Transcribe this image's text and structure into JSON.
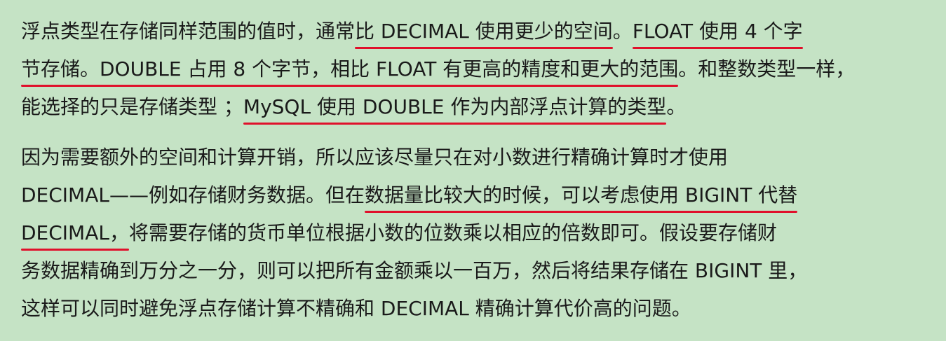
{
  "paragraphs": [
    {
      "lines": [
        [
          {
            "text": "浮点类型在存储同样范围的值时，通常",
            "underline": false,
            "style": ""
          },
          {
            "text": "比 DECIMAL 使用更少的空间",
            "underline": true,
            "style": ""
          },
          {
            "text": "。",
            "underline": false,
            "style": ""
          },
          {
            "text": "FLOAT 使用 4 个字",
            "underline": true,
            "style": ""
          }
        ],
        [
          {
            "text": "节存储。DOUBLE 占用 8 个字节，相比 FLOAT 有更高的精度和更大的范围",
            "underline": true,
            "style": ""
          },
          {
            "text": "。和整数类型一样，",
            "underline": false,
            "style": ""
          }
        ],
        [
          {
            "text": "能选择的只是存储类型 ；",
            "underline": false,
            "style": ""
          },
          {
            "text": "MySQL 使用 DOUBLE 作为内部浮点计算的类型",
            "underline": true,
            "style": ""
          },
          {
            "text": "。",
            "underline": false,
            "style": ""
          }
        ]
      ]
    },
    {
      "lines": [
        [
          {
            "text": "因为需要额外的空间和计算开销，所以应该尽量只在对小数进行精确计算时才使用",
            "underline": false,
            "style": ""
          }
        ],
        [
          {
            "text": "DECIMAL——例如存储财务数据。但在",
            "underline": false,
            "style": ""
          },
          {
            "text": "数据量比较大的时候，可以考虑使用 BIGINT 代替",
            "underline": true,
            "style": ""
          }
        ],
        [
          {
            "text": "DECIMAL，",
            "underline": true,
            "style": ""
          },
          {
            "text": "将需要存储的货币单位根据小数的位数乘以相应的倍数即可。假设要存储财",
            "underline": false,
            "style": ""
          }
        ],
        [
          {
            "text": "务数据精确到万分之一分，则可以把所有金额乘以一百万，然后将结果存储在 BIGINT 里，",
            "underline": false,
            "style": ""
          }
        ],
        [
          {
            "text": "这样可以同时避免浮点存储计算不精确和 DECIMAL 精确计算代价高的问题。",
            "underline": false,
            "style": ""
          }
        ]
      ]
    }
  ]
}
